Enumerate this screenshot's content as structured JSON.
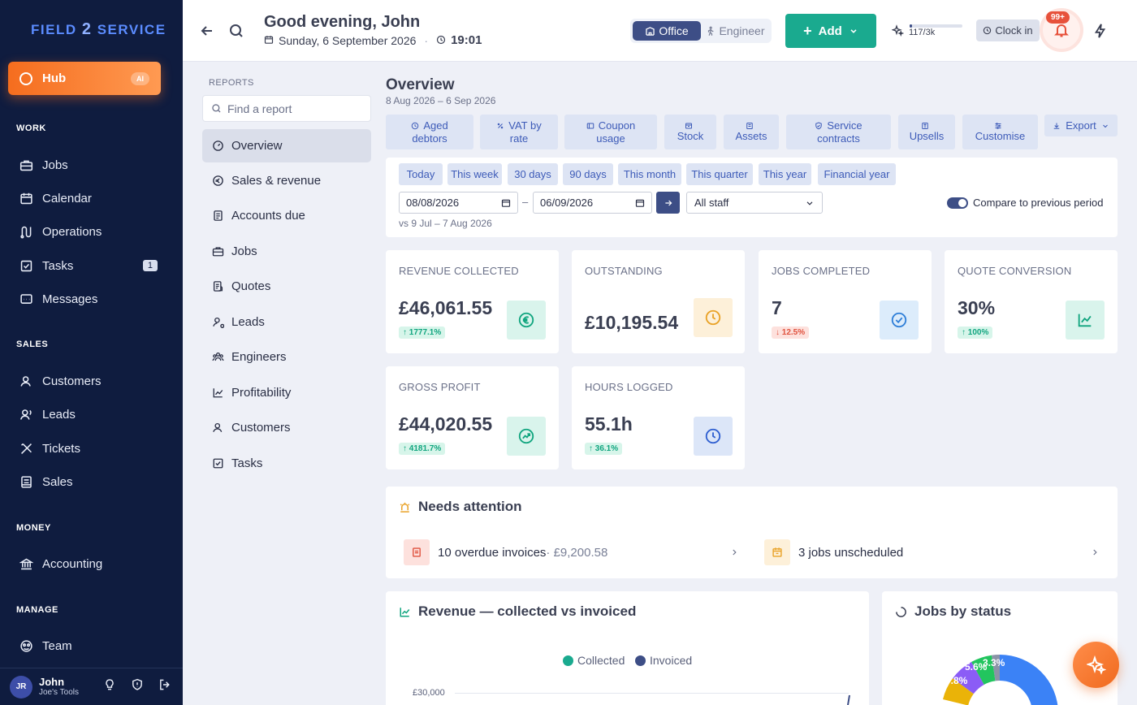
{
  "brand": {
    "name_a": "FIELD",
    "name_b": "2",
    "name_c": "SERVICE"
  },
  "sidebar": {
    "hub": {
      "label": "Hub",
      "badge": "AI"
    },
    "sections": [
      {
        "label": "WORK",
        "items": [
          {
            "label": "Jobs",
            "icon": "briefcase-icon"
          },
          {
            "label": "Calendar",
            "icon": "calendar-icon"
          },
          {
            "label": "Operations",
            "icon": "operations-icon"
          },
          {
            "label": "Tasks",
            "icon": "checkbox-icon",
            "badge": "1"
          },
          {
            "label": "Messages",
            "icon": "message-icon"
          }
        ]
      },
      {
        "label": "SALES",
        "items": [
          {
            "label": "Customers",
            "icon": "user-icon"
          },
          {
            "label": "Leads",
            "icon": "lead-icon"
          },
          {
            "label": "Tickets",
            "icon": "tools-icon"
          },
          {
            "label": "Sales",
            "icon": "receipt-icon"
          }
        ]
      },
      {
        "label": "MONEY",
        "items": [
          {
            "label": "Accounting",
            "icon": "bank-icon"
          }
        ]
      },
      {
        "label": "MANAGE",
        "items": [
          {
            "label": "Team",
            "icon": "team-icon"
          }
        ]
      }
    ],
    "user": {
      "initials": "JR",
      "name": "John",
      "org": "Joe's Tools"
    }
  },
  "topbar": {
    "greeting": "Good evening, John",
    "date": "Sunday, 6 September 2026",
    "separator": "·",
    "time": "19:01",
    "mode_office": "Office",
    "mode_engineer": "Engineer",
    "add_label": "Add",
    "ai_credits": "117/3k",
    "ai_credit_fraction": 0.039,
    "clock_in": "Clock in",
    "notif_badge": "99+"
  },
  "reports": {
    "section_label": "REPORTS",
    "search_placeholder": "Find a report",
    "items": [
      {
        "label": "Overview",
        "active": true
      },
      {
        "label": "Sales & revenue"
      },
      {
        "label": "Accounts due"
      },
      {
        "label": "Jobs"
      },
      {
        "label": "Quotes"
      },
      {
        "label": "Leads"
      },
      {
        "label": "Engineers"
      },
      {
        "label": "Profitability"
      },
      {
        "label": "Customers"
      },
      {
        "label": "Tasks"
      }
    ]
  },
  "overview": {
    "title": "Overview",
    "range": "8 Aug 2026 – 6 Sep 2026",
    "quick_tabs": [
      {
        "line1": "Aged",
        "line2": "debtors"
      },
      {
        "line1": "VAT by",
        "line2": "rate"
      },
      {
        "line1": "Coupon",
        "line2": "usage"
      },
      {
        "line1": "",
        "line2": "Stock"
      },
      {
        "line1": "",
        "line2": "Assets"
      },
      {
        "line1": "Service",
        "line2": "contracts"
      },
      {
        "line1": "",
        "line2": "Upsells"
      },
      {
        "line1": "",
        "line2": "Customise"
      }
    ],
    "export_label": "Export",
    "periods": [
      "Today",
      "This week",
      "30 days",
      "90 days",
      "This month",
      "This quarter",
      "This year",
      "Financial year"
    ],
    "date_from": "08/08/2026",
    "date_to": "06/09/2026",
    "date_dash": "–",
    "staff": "All staff",
    "vs_text": "vs 9 Jul – 7 Aug 2026",
    "compare_label": "Compare to previous period",
    "compare_on": true
  },
  "kpis": [
    {
      "label": "REVENUE COLLECTED",
      "value": "£46,061.55",
      "delta": "1777.1%",
      "dir": "up",
      "icon": "euro-icon",
      "color": "#11a57f",
      "bg": "#d9f4ec"
    },
    {
      "label": "OUTSTANDING",
      "value": "£10,195.54",
      "delta": "",
      "dir": "none",
      "icon": "clock-icon",
      "color": "#e9a227",
      "bg": "#fdf0d9"
    },
    {
      "label": "JOBS COMPLETED",
      "value": "7",
      "delta": "12.5%",
      "dir": "down",
      "icon": "check-circle-icon",
      "color": "#2f7fd8",
      "bg": "#dcecfb"
    },
    {
      "label": "QUOTE CONVERSION",
      "value": "30%",
      "delta": "100%",
      "dir": "up",
      "icon": "chart-line-icon",
      "color": "#11a57f",
      "bg": "#d9f4ec"
    },
    {
      "label": "GROSS PROFIT",
      "value": "£44,020.55",
      "delta": "4181.7%",
      "dir": "up",
      "icon": "trend-circle-icon",
      "color": "#11a57f",
      "bg": "#d9f4ec"
    },
    {
      "label": "HOURS LOGGED",
      "value": "55.1h",
      "delta": "36.1%",
      "dir": "up",
      "icon": "clock-icon",
      "color": "#2f5fd0",
      "bg": "#dce6f8"
    }
  ],
  "attention": {
    "title": "Needs attention",
    "items": [
      {
        "text": "10 overdue invoices",
        "muted": " · £9,200.58"
      },
      {
        "text": "3 jobs unscheduled",
        "muted": ""
      }
    ]
  },
  "revenue_chart": {
    "title": "Revenue — collected vs invoiced",
    "legend": [
      {
        "name": "Collected",
        "color": "#1aaa8f"
      },
      {
        "name": "Invoiced",
        "color": "#3d4e86"
      }
    ],
    "ytick_top": "£30,000"
  },
  "jobs_chart": {
    "title": "Jobs by status",
    "labels": [
      "5.6%",
      "3.3%",
      "7.8%"
    ]
  }
}
